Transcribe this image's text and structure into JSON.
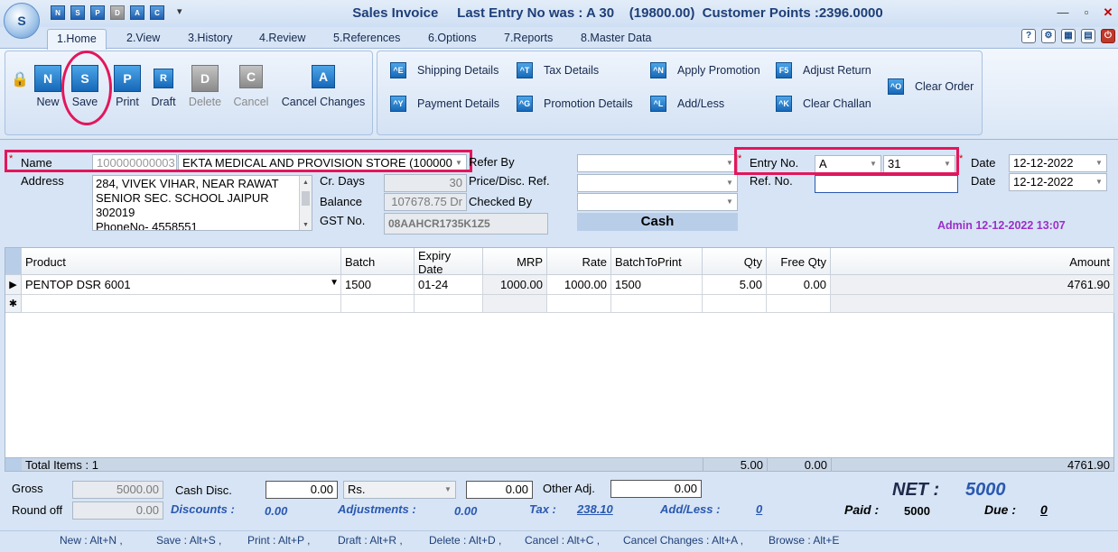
{
  "window": {
    "title": "Sales Invoice     Last Entry No was : A 30    (19800.00)  Customer Points :2396.0000",
    "quick_access": [
      "N",
      "S",
      "P",
      "D",
      "A",
      "C"
    ]
  },
  "tabs": [
    "1.Home",
    "2.View",
    "3.History",
    "4.Review",
    "5.References",
    "6.Options",
    "7.Reports",
    "8.Master Data"
  ],
  "ribbon": {
    "main_buttons": [
      {
        "label": "New",
        "icon": "N"
      },
      {
        "label": "Save",
        "icon": "S"
      },
      {
        "label": "Print",
        "icon": "P"
      },
      {
        "label": "Draft",
        "icon": "R"
      },
      {
        "label": "Delete",
        "icon": "D"
      },
      {
        "label": "Cancel",
        "icon": "C"
      },
      {
        "label": "Cancel Changes",
        "icon": "A"
      }
    ],
    "secondary": {
      "shipping": "Shipping Details",
      "payment": "Payment Details",
      "tax": "Tax Details",
      "promotion": "Promotion Details",
      "apply_promotion": "Apply Promotion",
      "add_less": "Add/Less",
      "adjust_return": "Adjust Return",
      "clear_challan": "Clear Challan",
      "clear_order": "Clear Order"
    },
    "secondary_icons": {
      "shipping": "^E",
      "payment": "^Y",
      "tax": "^T",
      "promotion": "^G",
      "apply_promotion": "^N",
      "add_less": "^L",
      "adjust_return": "F5",
      "clear_challan": "^K",
      "clear_order": "^O"
    }
  },
  "form": {
    "name_label": "Name",
    "name_code": "100000000003",
    "name_value": "EKTA MEDICAL AND PROVISION STORE (100000",
    "address_label": "Address",
    "address_lines": [
      "284, VIVEK VIHAR, NEAR RAWAT",
      "SENIOR  SEC. SCHOOL JAIPUR",
      "302019",
      "PhoneNo- 4558551"
    ],
    "cr_days_label": "Cr. Days",
    "cr_days_value": "30",
    "balance_label": "Balance",
    "balance_value": "107678.75 Dr",
    "gst_label": "GST No.",
    "gst_value": "08AAHCR1735K1Z5",
    "refer_by_label": "Refer By",
    "price_disc_label": "Price/Disc. Ref.",
    "checked_by_label": "Checked By",
    "payment_mode": "Cash",
    "entry_no_label": "Entry No.",
    "entry_series": "A",
    "entry_number": "31",
    "ref_no_label": "Ref. No.",
    "date_label": "Date",
    "date1": "12-12-2022",
    "date2": "12-12-2022",
    "admin_stamp": "Admin 12-12-2022 13:07"
  },
  "grid": {
    "headers": [
      "Product",
      "Batch",
      "Expiry Date",
      "MRP",
      "Rate",
      "BatchToPrint",
      "Qty",
      "Free Qty",
      "Amount"
    ],
    "rows": [
      {
        "product": "PENTOP DSR 6001",
        "batch": "1500",
        "expiry": "01-24",
        "mrp": "1000.00",
        "rate": "1000.00",
        "batch_to_print": "1500",
        "qty": "5.00",
        "free_qty": "0.00",
        "amount": "4761.90"
      }
    ],
    "totals": {
      "label": "Total Items : 1",
      "qty": "5.00",
      "free_qty": "0.00",
      "amount": "4761.90"
    }
  },
  "bottom": {
    "gross_label": "Gross",
    "gross_value": "5000.00",
    "round_off_label": "Round off",
    "round_off_value": "0.00",
    "cash_disc_label": "Cash Disc.",
    "cash_disc_value": "0.00",
    "cash_disc_unit": "Rs.",
    "cash_disc_amount": "0.00",
    "other_adj_label": "Other Adj.",
    "other_adj_value": "0.00",
    "discounts_label": "Discounts :",
    "discounts_value": "0.00",
    "adjustments_label": "Adjustments :",
    "adjustments_value": "0.00",
    "tax_label": "Tax :",
    "tax_value": "238.10",
    "add_less_label": "Add/Less :",
    "add_less_value": "0",
    "net_label": "NET :",
    "net_value": "5000",
    "paid_label": "Paid :",
    "paid_value": "5000",
    "due_label": "Due :",
    "due_value": "0"
  },
  "statusbar": [
    "New : Alt+N ,",
    "Save : Alt+S ,",
    "Print : Alt+P ,",
    "Draft : Alt+R ,",
    "Delete : Alt+D ,",
    "Cancel : Alt+C ,",
    "Cancel Changes : Alt+A ,",
    "Browse : Alt+E"
  ]
}
